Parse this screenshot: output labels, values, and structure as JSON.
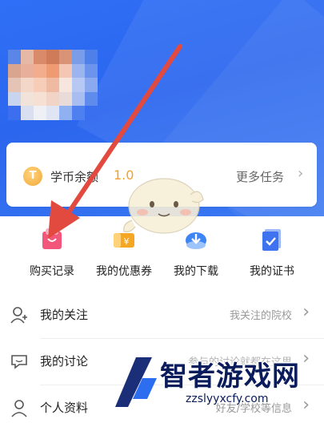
{
  "colors": {
    "header_blue": "#2f6ff6",
    "accent_orange": "#f0a232",
    "arrow_red": "#e34a3f"
  },
  "balance": {
    "coin_icon": "coin-icon",
    "coin_glyph": "T",
    "label": "学币余额",
    "value": "1.0",
    "more_tasks": "更多任务"
  },
  "shortcuts": [
    {
      "label": "购买记录",
      "icon": "shopping-bag-icon"
    },
    {
      "label": "我的优惠券",
      "icon": "coupon-icon"
    },
    {
      "label": "我的下载",
      "icon": "download-cloud-icon"
    },
    {
      "label": "我的证书",
      "icon": "certificate-icon"
    }
  ],
  "list": [
    {
      "title": "我的关注",
      "hint": "我关注的院校",
      "icon": "user-follow-icon"
    },
    {
      "title": "我的讨论",
      "hint": "参与的讨论就都在这里",
      "icon": "chat-bubble-icon"
    },
    {
      "title": "个人资料",
      "hint": "好友/学校等信息",
      "icon": "profile-icon"
    }
  ],
  "watermark": {
    "title": "智者游戏网",
    "url": "zzslyyxcfy.com"
  }
}
